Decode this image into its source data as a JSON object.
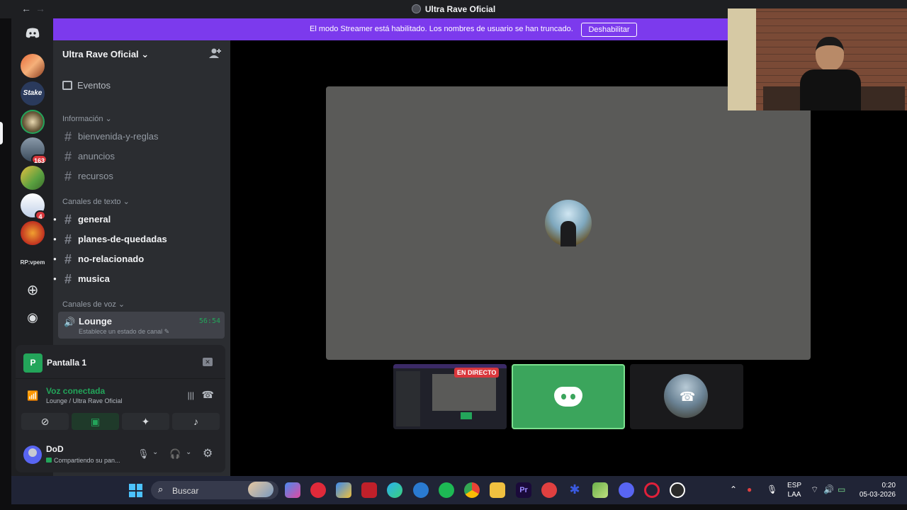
{
  "titlebar": {
    "title": "Ultra Rave Oficial",
    "back": "←",
    "forward": "→"
  },
  "banner": {
    "text": "El modo Streamer está habilitado. Los nombres de usuario se han truncado.",
    "button": "Deshabilitar"
  },
  "rail": {
    "badges": {
      "server_4": "163",
      "server_7": "4"
    },
    "text_server": "RP:vpem"
  },
  "guild": {
    "name": "Ultra Rave Oficial",
    "events_label": "Eventos",
    "categories": {
      "info": "Información",
      "text": "Canales de texto",
      "voice": "Canales de voz"
    },
    "info_channels": [
      "bienvenida-y-reglas",
      "anuncios",
      "recursos"
    ],
    "text_channels": [
      "general",
      "planes-de-quedadas",
      "no-relacionado",
      "musica"
    ],
    "voice_channel": {
      "name": "Lounge",
      "status": "Establece un estado de canal",
      "timer": "56:54"
    }
  },
  "rtc": {
    "stream_label": "Pantalla 1",
    "stream_app_letter": "P",
    "connected": "Voz conectada",
    "location": "Lounge / Ultra Rave Oficial"
  },
  "user": {
    "name": "DoD",
    "status": "Compartiendo su pan..."
  },
  "stage": {
    "live_badge": "EN DIRECTO"
  },
  "taskbar": {
    "search": "Buscar",
    "lang_top": "ESP",
    "lang_bottom": "LAA",
    "time": "0:20",
    "date": "05-03-2026"
  },
  "colors": {
    "accent": "#7c3aed",
    "online": "#23a55a",
    "danger": "#da373c",
    "sidebar": "#2b2d31"
  }
}
